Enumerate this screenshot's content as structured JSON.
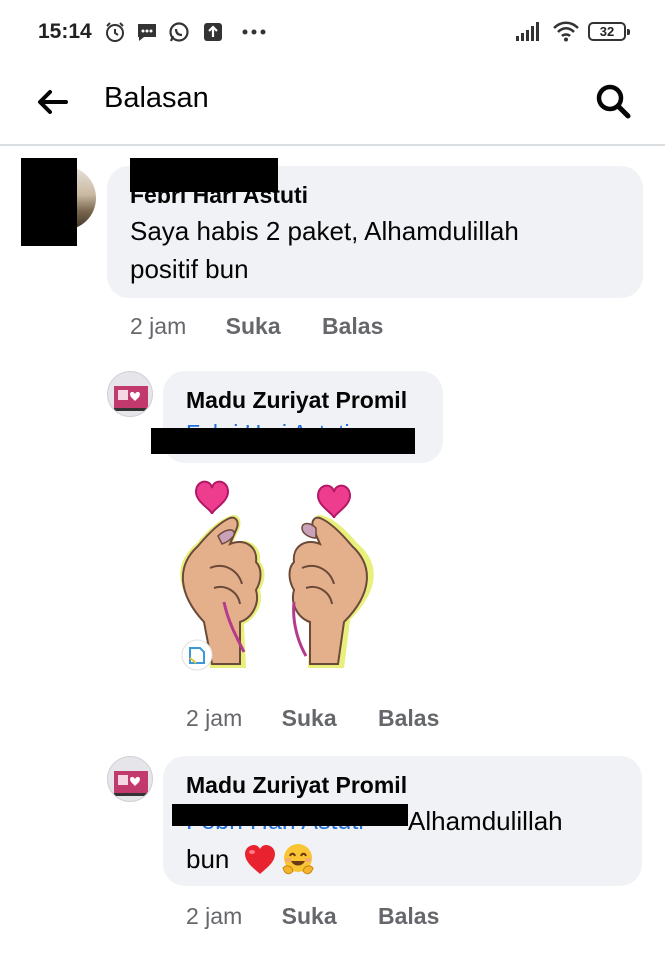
{
  "status_bar": {
    "time": "15:14",
    "battery": "32",
    "left_icons": [
      "alarm-icon",
      "message-icon",
      "whatsapp-icon",
      "upload-icon",
      "more-dots-icon"
    ],
    "right_icons": [
      "signal-icon",
      "wifi-icon",
      "battery-icon"
    ]
  },
  "app_bar": {
    "title": "Balasan"
  },
  "comments": [
    {
      "author": "Febri Hari Astuti",
      "text_line1": "Saya habis 2 paket, Alhamdulillah",
      "text_line2": "positif bun",
      "time": "2 jam",
      "like": "Suka",
      "reply": "Balas"
    },
    {
      "author": "Madu Zuriyat Promil",
      "mention": "Febri Hari Astuti",
      "sticker": "heart-finger-sticker",
      "time": "2 jam",
      "like": "Suka",
      "reply": "Balas"
    },
    {
      "author": "Madu Zuriyat Promil",
      "mention": "Febri Hari Astuti",
      "text_after_mention": "Alhamdulillah",
      "text_line2": "bun",
      "emoji": "❤️🤗",
      "time": "2 jam",
      "like": "Suka",
      "reply": "Balas"
    }
  ],
  "colors": {
    "bubble": "#f0f2f5",
    "mention": "#216fdb",
    "meta": "#65676b",
    "heart": "#ee3d8f"
  }
}
